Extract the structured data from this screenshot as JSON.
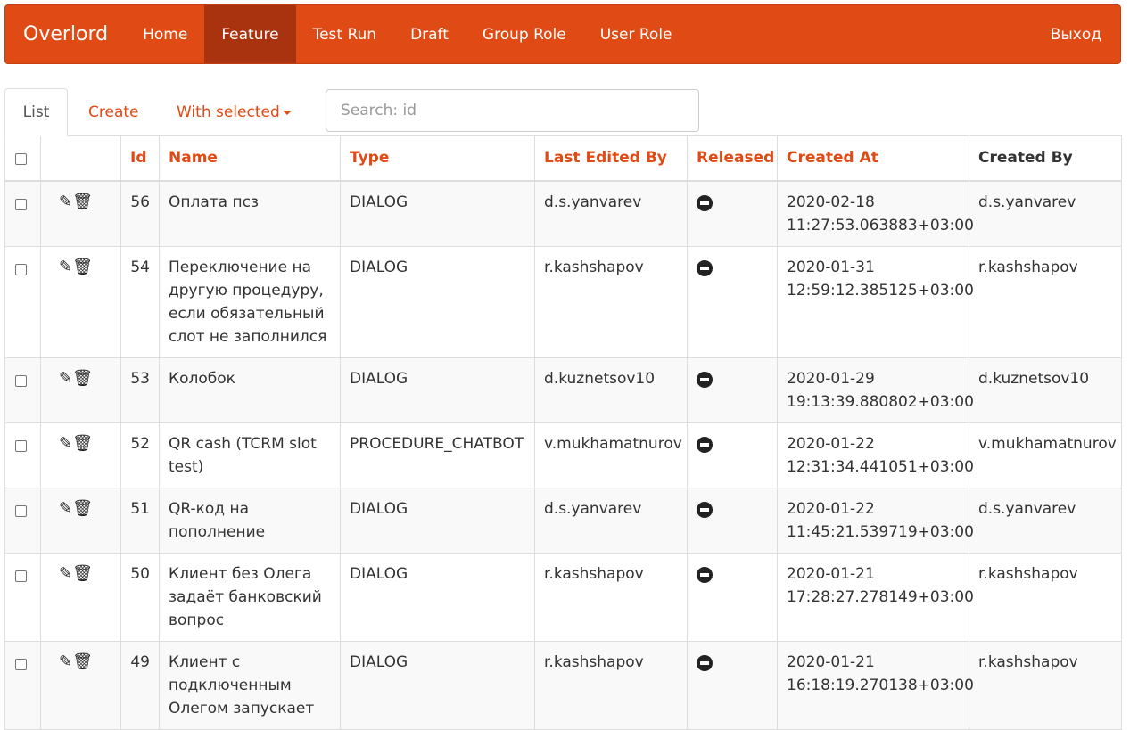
{
  "navbar": {
    "brand": "Overlord",
    "items": [
      {
        "label": "Home",
        "active": false
      },
      {
        "label": "Feature",
        "active": true
      },
      {
        "label": "Test Run",
        "active": false
      },
      {
        "label": "Draft",
        "active": false
      },
      {
        "label": "Group Role",
        "active": false
      },
      {
        "label": "User Role",
        "active": false
      }
    ],
    "logout": "Выход"
  },
  "tabs": {
    "list": "List",
    "create": "Create",
    "with_selected": "With selected"
  },
  "search": {
    "placeholder": "Search: id"
  },
  "table": {
    "headers": {
      "id": "Id",
      "name": "Name",
      "type": "Type",
      "last_edited_by": "Last Edited By",
      "released": "Released",
      "created_at": "Created At",
      "created_by": "Created By"
    },
    "rows": [
      {
        "id": "56",
        "name": "Оплата псз",
        "type": "DIALOG",
        "last_edited_by": "d.s.yanvarev",
        "created_at": "2020-02-18 11:27:53.063883+03:00",
        "created_by": "d.s.yanvarev"
      },
      {
        "id": "54",
        "name": "Переключение на другую процедуру, если обязательный слот не заполнился",
        "type": "DIALOG",
        "last_edited_by": "r.kashshapov",
        "created_at": "2020-01-31 12:59:12.385125+03:00",
        "created_by": "r.kashshapov"
      },
      {
        "id": "53",
        "name": "Колобок",
        "type": "DIALOG",
        "last_edited_by": "d.kuznetsov10",
        "created_at": "2020-01-29 19:13:39.880802+03:00",
        "created_by": "d.kuznetsov10"
      },
      {
        "id": "52",
        "name": "QR cash (TCRM slot test)",
        "type": "PROCEDURE_CHATBOT",
        "last_edited_by": "v.mukhamatnurov",
        "created_at": "2020-01-22 12:31:34.441051+03:00",
        "created_by": "v.mukhamatnurov"
      },
      {
        "id": "51",
        "name": "QR-код на пополнение",
        "type": "DIALOG",
        "last_edited_by": "d.s.yanvarev",
        "created_at": "2020-01-22 11:45:21.539719+03:00",
        "created_by": "d.s.yanvarev"
      },
      {
        "id": "50",
        "name": "Клиент без Олега задаёт банковский вопрос",
        "type": "DIALOG",
        "last_edited_by": "r.kashshapov",
        "created_at": "2020-01-21 17:28:27.278149+03:00",
        "created_by": "r.kashshapov"
      },
      {
        "id": "49",
        "name": "Клиент с подключенным Олегом запускает",
        "type": "DIALOG",
        "last_edited_by": "r.kashshapov",
        "created_at": "2020-01-21 16:18:19.270138+03:00",
        "created_by": "r.kashshapov"
      }
    ]
  },
  "icons": {
    "edit": "pencil-icon",
    "delete": "trash-icon",
    "released": "minus-circle-icon"
  },
  "colors": {
    "brand": "#e04a14",
    "active_nav": "#a9330e"
  }
}
